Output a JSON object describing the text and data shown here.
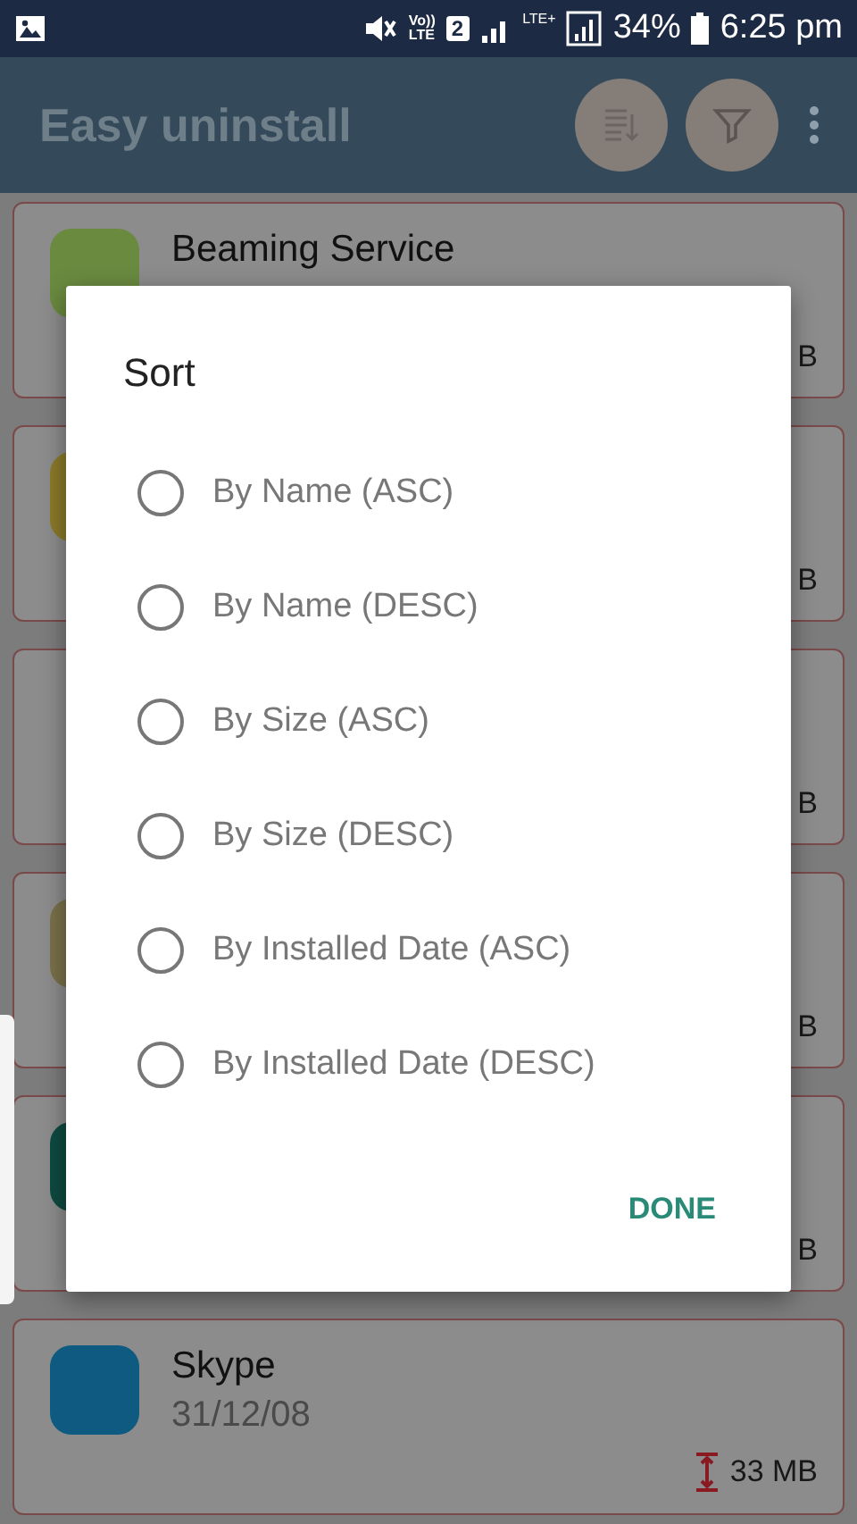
{
  "status_bar": {
    "volte_top": "Vo))",
    "volte_bottom": "LTE",
    "sim": "2",
    "lte_plus": "LTE+",
    "battery": "34%",
    "time": "6:25 pm"
  },
  "app_bar": {
    "title": "Easy uninstall"
  },
  "apps": [
    {
      "name": "Beaming Service",
      "size": "B",
      "color": "#6a8a40",
      "size_icon": false
    },
    {
      "size": "B",
      "color": "#8a7a2a",
      "size_icon": false
    },
    {
      "size": "B",
      "size_icon": false
    },
    {
      "size": "B",
      "color": "#7a704a",
      "size_icon": false
    },
    {
      "size": "B",
      "color": "#0e4a40",
      "size_icon": false
    },
    {
      "name": "Skype",
      "date": "31/12/08",
      "size": "33 MB",
      "color": "#0e5a80",
      "size_icon": true
    }
  ],
  "dialog": {
    "title": "Sort",
    "options": [
      {
        "label": "By Name (ASC)",
        "selected": false
      },
      {
        "label": "By Name (DESC)",
        "selected": false
      },
      {
        "label": "By Size (ASC)",
        "selected": false
      },
      {
        "label": "By Size (DESC)",
        "selected": false
      },
      {
        "label": "By Installed Date (ASC)",
        "selected": false
      },
      {
        "label": "By Installed Date (DESC)",
        "selected": false
      }
    ],
    "button": "DONE"
  }
}
